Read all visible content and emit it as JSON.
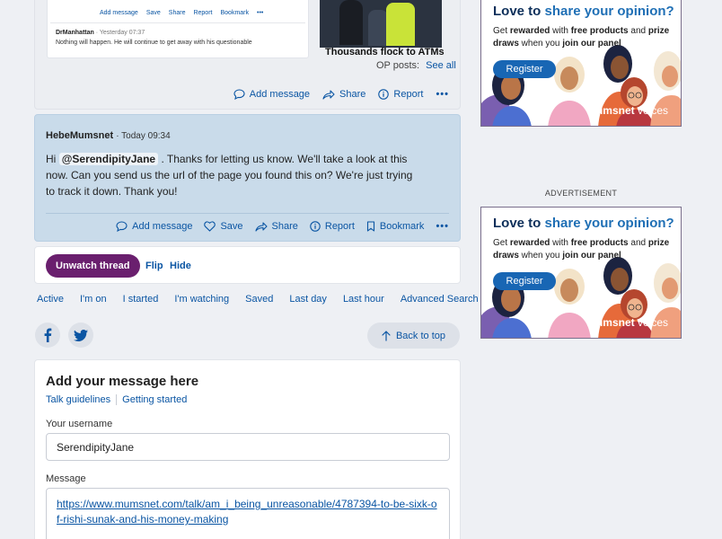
{
  "top_post": {
    "embed": {
      "actions": [
        "Add message",
        "Save",
        "Share",
        "Report",
        "Bookmark"
      ],
      "author": "DrManhattan",
      "time": "· Yesterday 07:37",
      "body": "Nothing will happen. He will continue to get away with his questionable"
    },
    "news_title": "Thousands flock to ATMs",
    "op_posts_label": "OP posts:",
    "op_posts_link": "See all",
    "actions": {
      "add": "Add message",
      "share": "Share",
      "report": "Report",
      "more": "•••"
    }
  },
  "reply": {
    "author": "HebeMumsnet",
    "time": "· Today 09:34",
    "greeting": "Hi",
    "mention": "@SerendipityJane",
    "body": ". Thanks for letting us know. We'll take a look at this now. Can you send us the url of the page you found this on? We're just trying to track it down. Thank you!",
    "actions": {
      "add": "Add message",
      "save": "Save",
      "share": "Share",
      "report": "Report",
      "bookmark": "Bookmark",
      "more": "•••"
    }
  },
  "watch": {
    "unwatch": "Unwatch thread",
    "flip": "Flip",
    "hide": "Hide"
  },
  "nav": [
    "Active",
    "I'm on",
    "I started",
    "I'm watching",
    "Saved",
    "Last day",
    "Last hour",
    "Advanced Search"
  ],
  "social": {
    "back_to_top": "Back to top"
  },
  "compose": {
    "title": "Add your message here",
    "talk_guidelines": "Talk guidelines",
    "getting_started": "Getting started",
    "username_label": "Your username",
    "username_value": "SerendipityJane",
    "message_label": "Message",
    "message_link": "https://www.mumsnet.com/talk/am_i_being_unreasonable/4787394-to-be-sixk-of-rishi-sunak-and-his-money-making"
  },
  "ads": {
    "label": "ADVERTISEMENT",
    "headline_pre": "Love to ",
    "headline_hl": "share your opinion?",
    "sub_1": "Get ",
    "sub_b1": "rewarded",
    "sub_2": " with ",
    "sub_b2": "free products",
    "sub_3": " and ",
    "sub_b3": "prize draws",
    "sub_4": " when you ",
    "sub_b4": "join our panel",
    "register": "Register",
    "brand_1": "mumsnet",
    "brand_2": " voices"
  },
  "colors": {
    "link": "#0a55a3",
    "staff_bg": "#c9dbea",
    "unwatch_bg": "#6a1f6e",
    "ad_blue": "#1866b4"
  }
}
